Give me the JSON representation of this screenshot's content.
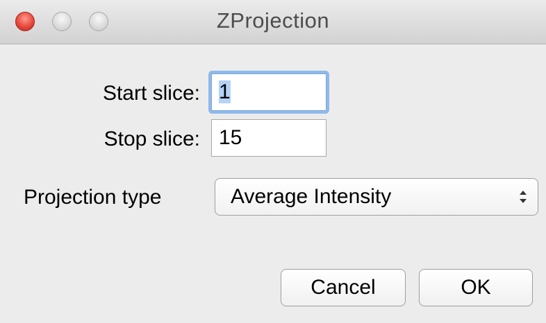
{
  "window": {
    "title": "ZProjection"
  },
  "form": {
    "start_slice_label": "Start slice:",
    "start_slice_value": "1",
    "stop_slice_label": "Stop slice:",
    "stop_slice_value": "15",
    "projection_type_label": "Projection type",
    "projection_type_value": "Average Intensity"
  },
  "buttons": {
    "cancel_label": "Cancel",
    "ok_label": "OK"
  },
  "icons": {
    "close": "close-icon",
    "minimize": "minimize-icon",
    "zoom": "zoom-icon",
    "select_arrows": "updown-icon"
  },
  "colors": {
    "close_button": "#e8493c",
    "focus_ring": "#8fb9ea",
    "selection_highlight": "#b3d3f8",
    "window_background": "#ececec"
  }
}
